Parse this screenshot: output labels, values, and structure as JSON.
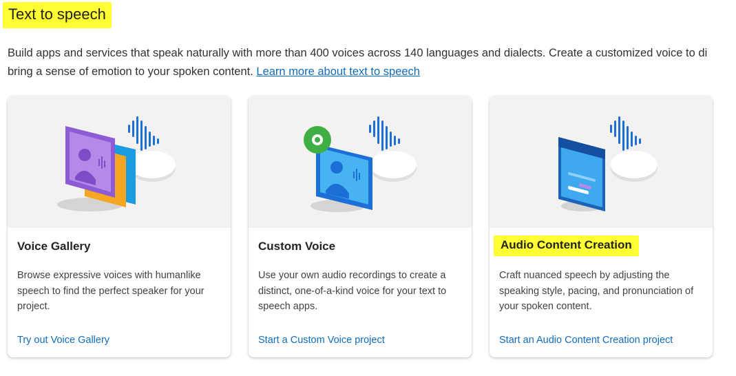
{
  "header": {
    "title": "Text to speech",
    "intro_line1": "Build apps and services that speak naturally with more than 400 voices across 140 languages and dialects. Create a customized voice to di",
    "intro_line2_prefix": "bring a sense of emotion to your spoken content.",
    "learn_more_link": "Learn more about text to speech"
  },
  "cards": [
    {
      "title": "Voice Gallery",
      "description": "Browse expressive voices with humanlike speech to find the perfect speaker for your project.",
      "cta": "Try out Voice Gallery",
      "illustration": "voice-gallery-illustration"
    },
    {
      "title": "Custom Voice",
      "description": "Use your own audio recordings to create a distinct, one-of-a-kind voice for your text to speech apps.",
      "cta": "Start a Custom Voice project",
      "illustration": "custom-voice-illustration"
    },
    {
      "title": "Audio Content Creation",
      "description": "Craft nuanced speech by adjusting the speaking style, pacing, and pronunciation of your spoken content.",
      "cta": "Start an Audio Content Creation project",
      "illustration": "audio-content-creation-illustration"
    }
  ],
  "colors": {
    "highlight": "#ffff33",
    "link": "#0f6cbd",
    "card_art_bg": "#f3f2f1",
    "wave_blue": "#1b6fd6",
    "gallery_purple": "#8e5bd6",
    "gallery_orange": "#f5a623",
    "custom_green": "#3fae45",
    "editor_blue": "#2f9bea"
  }
}
